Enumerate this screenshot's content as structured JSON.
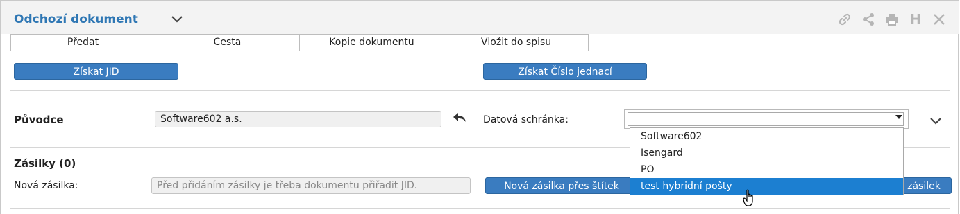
{
  "header": {
    "title": "Odchozí dokument",
    "icons": [
      "link-icon",
      "share-icon",
      "print-icon",
      "history-icon",
      "close-icon"
    ],
    "history_glyph": "H"
  },
  "tabs": [
    {
      "label": "Předat"
    },
    {
      "label": "Cesta"
    },
    {
      "label": "Kopie dokumentu"
    },
    {
      "label": "Vložit do spisu"
    }
  ],
  "actions": {
    "get_jid": "Získat JID",
    "get_ref_number": "Získat Číslo jednací"
  },
  "originator": {
    "label": "Původce",
    "value": "Software602 a.s.",
    "data_box_label": "Datová schránka:",
    "data_box_value": "",
    "options": [
      {
        "label": "Software602",
        "selected": false
      },
      {
        "label": "Isengard",
        "selected": false
      },
      {
        "label": "PO",
        "selected": false
      },
      {
        "label": "test hybridní pošty",
        "selected": true
      }
    ]
  },
  "shipments": {
    "title": "Zásilky (0)",
    "new_label": "Nová zásilka:",
    "new_placeholder": "Před přidáním zásilky je třeba dokumentu přiřadit JID.",
    "new_via_label_button": "Nová zásilka přes štítek",
    "partial_button_label": "zásilek"
  },
  "colors": {
    "accent": "#2f77b4",
    "button": "#3a7cc0",
    "selected_option": "#1c7fd1"
  }
}
